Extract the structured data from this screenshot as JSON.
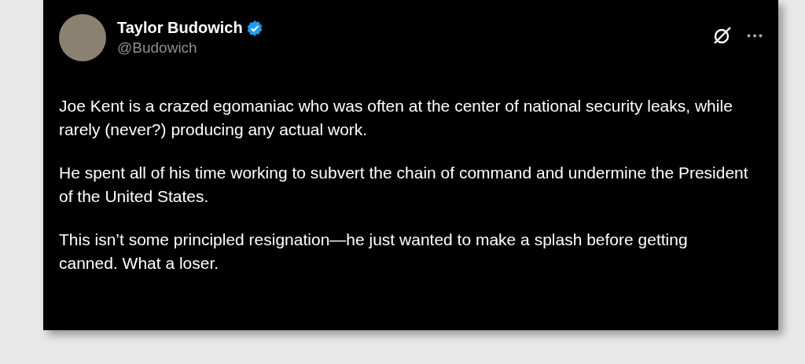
{
  "post": {
    "author": {
      "name": "Taylor Budowich",
      "handle": "@Budowich",
      "verified": true
    },
    "paragraphs": [
      "Joe Kent is a crazed egomaniac who was often at the center of national security leaks, while rarely (never?) producing any actual work.",
      "He spent all of his time working to subvert the chain of command and undermine the President of the United States.",
      "This isn’t some principled resignation—he just wanted to make a splash before getting canned. What a loser."
    ]
  }
}
